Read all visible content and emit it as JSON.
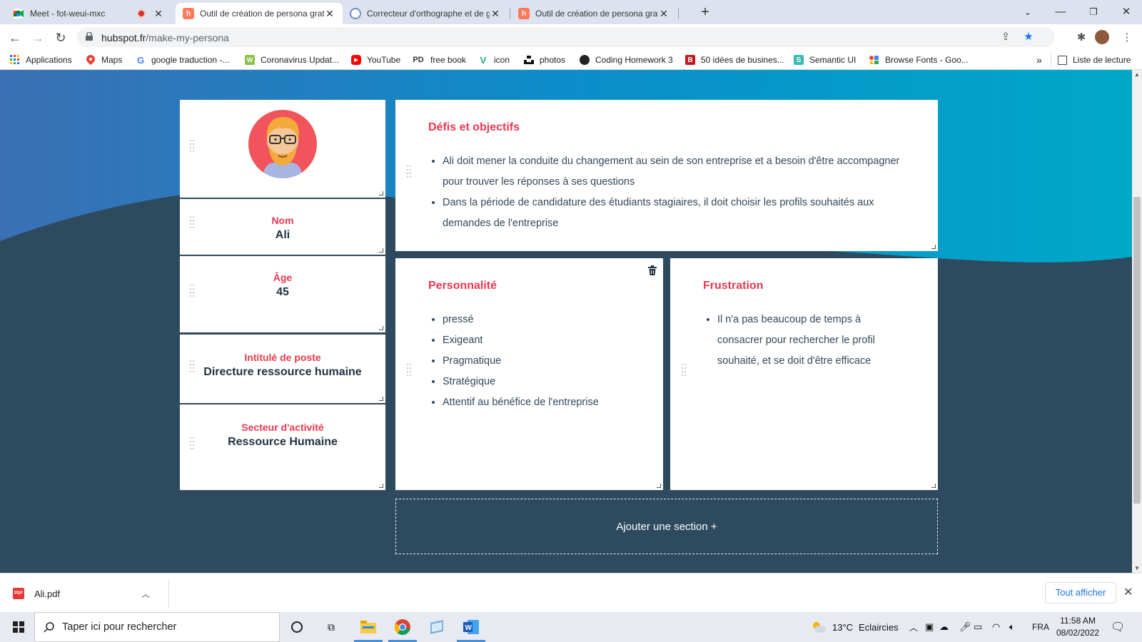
{
  "browser": {
    "tabs": [
      {
        "title": "Meet - fot-weui-mxc",
        "icon": "google-meet-icon",
        "recording": true
      },
      {
        "title": "Outil de création de persona gratuit",
        "icon": "hubspot-icon",
        "active": true
      },
      {
        "title": "Correcteur d'orthographe et de grammaire",
        "icon": "reverso-icon"
      },
      {
        "title": "Outil de création de persona gratuit",
        "icon": "hubspot-icon"
      }
    ],
    "new_tab": "+",
    "url_host": "hubspot.fr",
    "url_path": "/make-my-persona",
    "bookmarks": [
      {
        "label": "Applications",
        "icon": "apps-grid-icon"
      },
      {
        "label": "Maps",
        "icon": "maps-pin-icon"
      },
      {
        "label": "google traduction -...",
        "icon": "google-icon"
      },
      {
        "label": "Coronavirus Updat...",
        "icon": "worldometer-icon"
      },
      {
        "label": "YouTube",
        "icon": "youtube-icon"
      },
      {
        "label": "free book",
        "icon": "pdf-drive-icon"
      },
      {
        "label": "icon",
        "icon": "vuetify-icon"
      },
      {
        "label": "photos",
        "icon": "unsplash-icon"
      },
      {
        "label": "Coding Homework 3",
        "icon": "github-icon"
      },
      {
        "label": "50 idées de busines...",
        "icon": "b-icon"
      },
      {
        "label": "Semantic UI",
        "icon": "semantic-ui-icon"
      },
      {
        "label": "Browse Fonts - Goo...",
        "icon": "google-fonts-icon"
      }
    ],
    "more_bookmarks": "»",
    "reading_list": "Liste de lecture"
  },
  "persona": {
    "fields": [
      {
        "label": "Nom",
        "value": "Ali"
      },
      {
        "label": "Âge",
        "value": "45"
      },
      {
        "label": "Intitulé de poste",
        "value": "Directure ressource humaine"
      },
      {
        "label": "Secteur d'activité",
        "value": "Ressource Humaine"
      }
    ],
    "sections": {
      "defis": {
        "title": "Défis et objectifs",
        "items": [
          " Ali doit mener la conduite du changement au sein de son entreprise et a besoin d'être accompagner pour trouver les réponses à ses questions",
          "Dans la période de candidature des étudiants stagiaires, il doit choisir les profils souhaités aux demandes de l'entreprise"
        ]
      },
      "personnalite": {
        "title": "Personnalité",
        "items": [
          "pressé",
          "Exigeant",
          "Pragmatique",
          "Stratégique",
          "Attentif au bénéfice de l'entreprise"
        ]
      },
      "frustration": {
        "title": "Frustration",
        "items": [
          " Il n'a pas beaucoup de temps à consacrer pour rechercher le profil souhaité, et se doit d'être efficace"
        ]
      }
    },
    "add_section": "Ajouter une section +"
  },
  "downloads": {
    "file": "Ali.pdf",
    "show_all": "Tout afficher"
  },
  "taskbar": {
    "search_placeholder": "Taper ici pour rechercher",
    "weather_temp": "13°C",
    "weather_desc": "Eclaircies",
    "language": "FRA",
    "time": "11:58 AM",
    "date": "08/02/2022"
  },
  "colors": {
    "accent": "#e8384f",
    "page_bg": "#2e4a5e",
    "wave_blue": "#0a8fc8"
  }
}
